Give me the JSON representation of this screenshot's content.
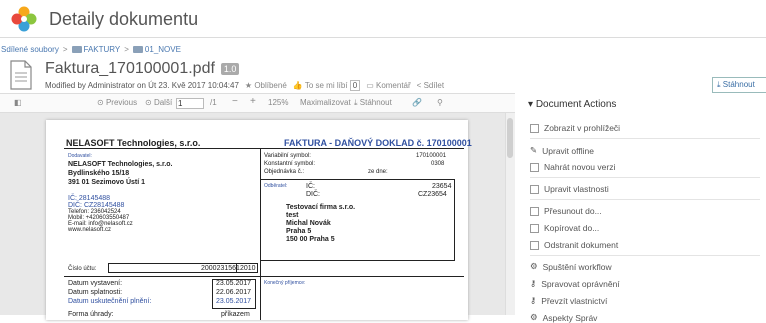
{
  "header": {
    "title": "Detaily dokumentu"
  },
  "breadcrumb": {
    "items": [
      "Sdílené soubory",
      "FAKTURY",
      "01_NOVE"
    ],
    "sep": ">"
  },
  "document": {
    "name": "Faktura_170100001.pdf",
    "version": "1.0",
    "modified": "Modified by Administrator on Út 23. Kvě 2017 10:04:47",
    "favorite": "Oblíbené",
    "like": "To se mi líbí",
    "like_count": "0",
    "comment": "Komentář",
    "share": "Sdílet"
  },
  "actions_top": {
    "download": "Stáhnout"
  },
  "toolbar": {
    "previous": "Previous",
    "next": "Další",
    "page": "1",
    "pages": "/1",
    "zoom": "125%",
    "maximize": "Maximalizovat",
    "download": "Stáhnout"
  },
  "invoice": {
    "company": "NELASOFT Technologies, s.r.o.",
    "heading": "FAKTURA - DAŇOVÝ DOKLAD č. 170100001",
    "supplier_label": "Dodavatel:",
    "supplier_name": "NELASOFT Technologies, s.r.o.",
    "supplier_street": "Bydlinského 15/18",
    "supplier_city": "391 01 Sezimovo Ústí 1",
    "ic": "IČ: 28145488",
    "dic": "DIČ: CZ28145488",
    "phone": "Telefon: 236042524",
    "mobile": "Mobil: +420603550487",
    "email": "E-mail: info@nelasoft.cz",
    "web": "www.nelasoft.cz",
    "vs_label": "Variabilní symbol:",
    "vs": "170100001",
    "ks_label": "Konstantní symbol:",
    "ks": "0308",
    "order_label": "Objednávka č.:",
    "order_date": "ze dne:",
    "buyer_label": "Odběratel:",
    "buyer_ic_label": "IČ:",
    "buyer_ic": "23654",
    "buyer_dic_label": "DIČ:",
    "buyer_dic": "CZ23654",
    "buyer_name": "Testovací firma s.r.o.",
    "buyer_l2": "test",
    "buyer_l3": "Michal Novák",
    "buyer_l4": "Praha 5",
    "buyer_l5": "150 00 Praha 5",
    "account_label": "Číslo účtu:",
    "account": "2000231561",
    "bank": "2010",
    "d1_label": "Datum vystavení:",
    "d1": "23.05.2017",
    "d2_label": "Datum splatnosti:",
    "d2": "22.06.2017",
    "d3_label": "Datum uskutečnění plnění:",
    "d3": "23.05.2017",
    "pay_label": "Forma úhrady:",
    "pay": "příkazem",
    "final_label": "Konečný příjemce:"
  },
  "panel": {
    "title": "Document Actions",
    "items": [
      "Zobrazit v prohlížeči",
      "Upravit offline",
      "Nahrát novou verzi",
      "Upravit vlastnosti",
      "Přesunout do...",
      "Kopírovat do...",
      "Odstranit dokument",
      "Spuštění workflow",
      "Spravovat oprávnění",
      "Převzít vlastnictví",
      "Aspekty Správ"
    ]
  }
}
